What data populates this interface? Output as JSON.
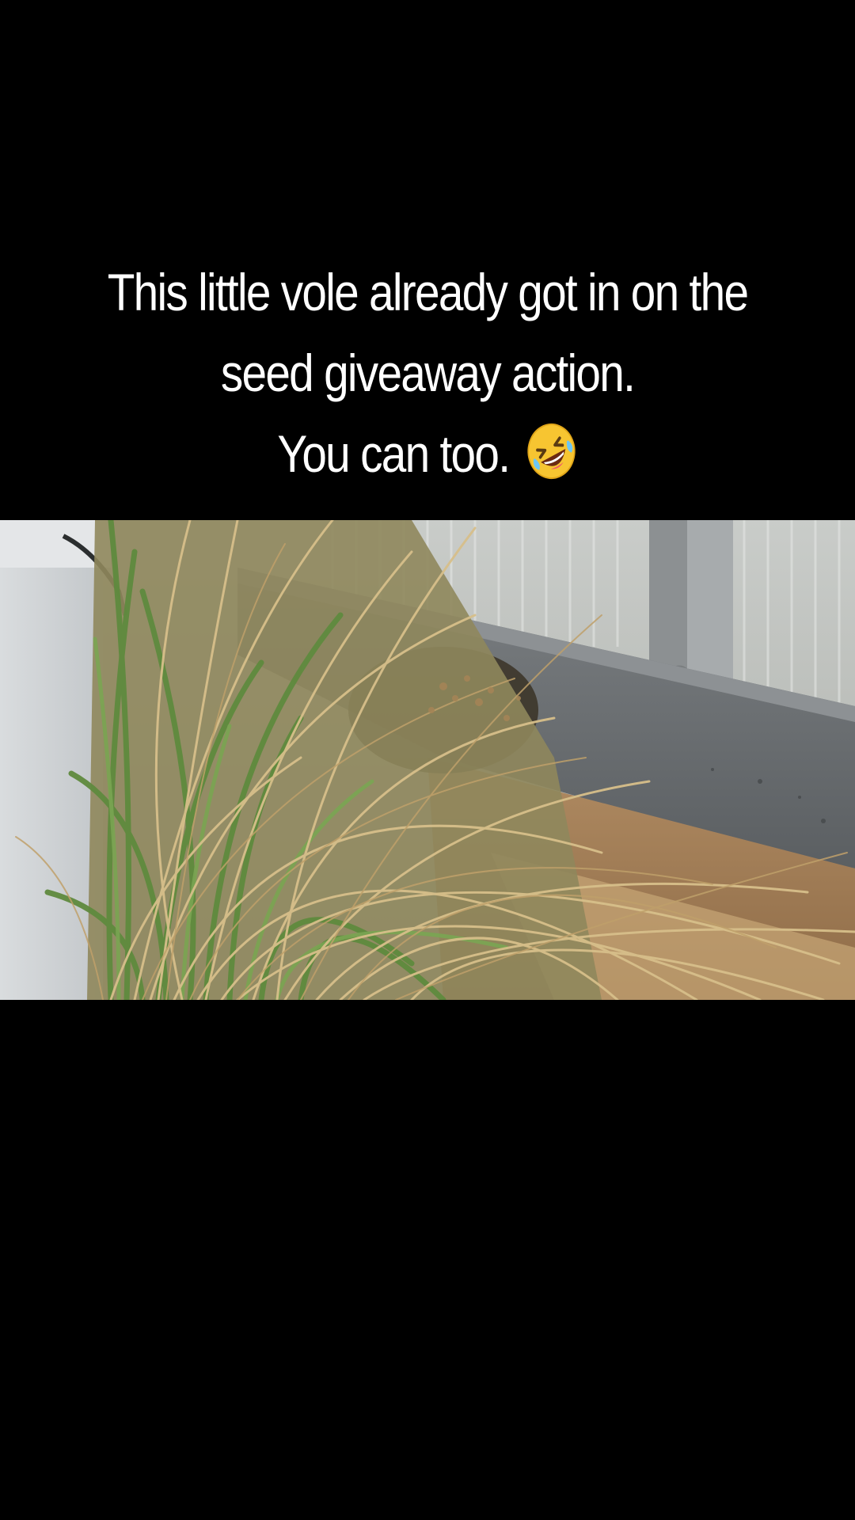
{
  "caption": {
    "line1": "This little vole already got in on the",
    "line2": "seed giveaway action.",
    "line3": "You can too."
  },
  "emoji": "rolling-on-the-floor-laughing-emoji",
  "colors": {
    "background": "#000000",
    "caption_text": "#ffffff"
  }
}
